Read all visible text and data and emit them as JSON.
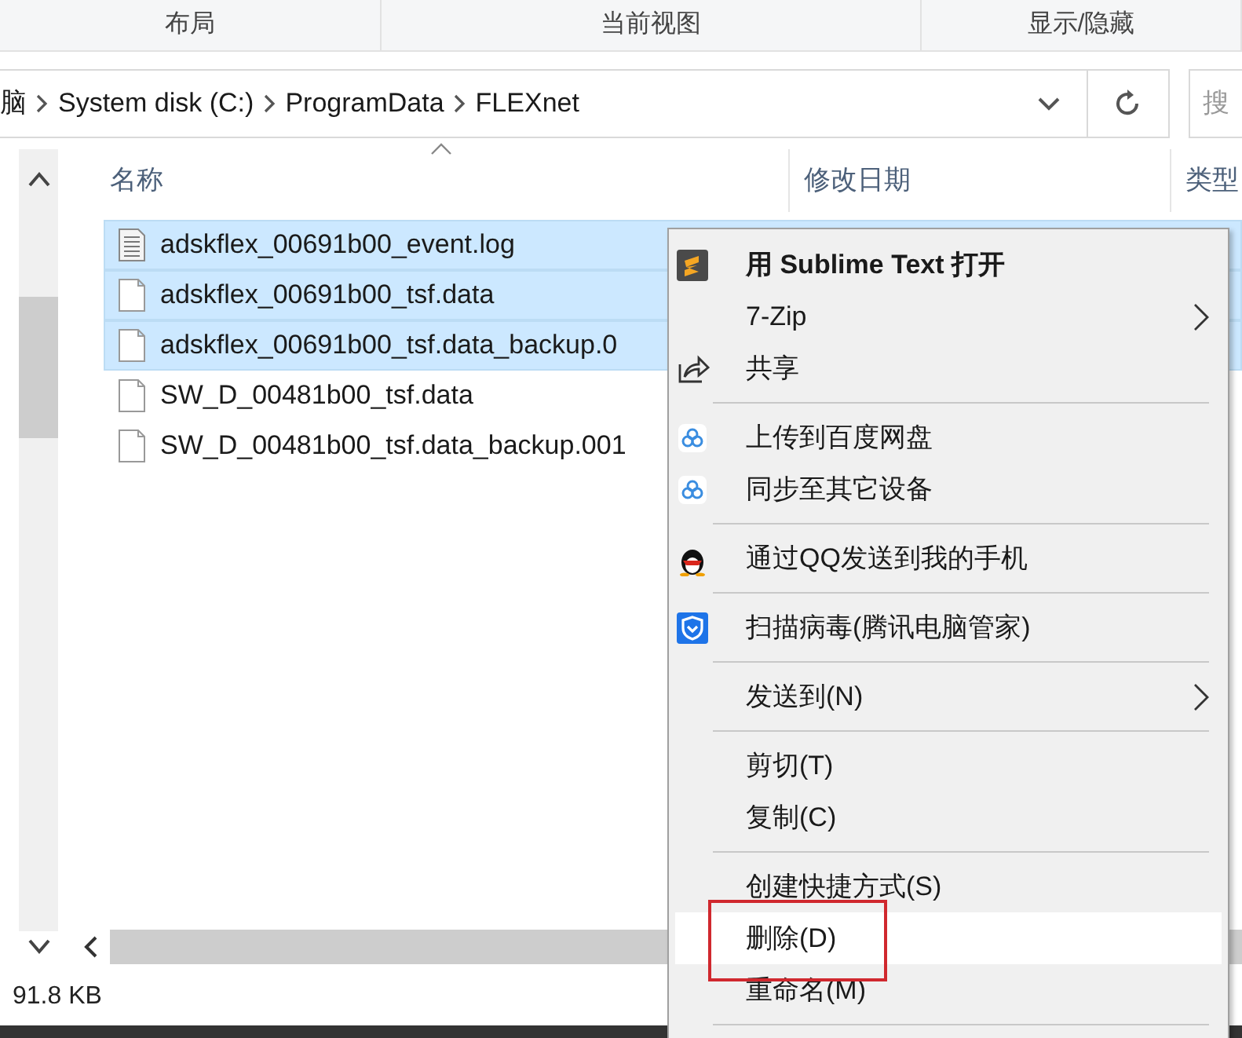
{
  "ribbon_groups": [
    "布局",
    "当前视图",
    "显示/隐藏"
  ],
  "address_bar": {
    "breadcrumbs": [
      "脑",
      "System disk (C:)",
      "ProgramData",
      "FLEXnet"
    ],
    "search_placeholder": "搜"
  },
  "columns": [
    "名称",
    "修改日期",
    "类型"
  ],
  "files": [
    {
      "name": "adskflex_00691b00_event.log",
      "kind": "text",
      "selected": true
    },
    {
      "name": "adskflex_00691b00_tsf.data",
      "kind": "blank",
      "selected": true
    },
    {
      "name": "adskflex_00691b00_tsf.data_backup.0",
      "kind": "blank",
      "selected": true
    },
    {
      "name": "SW_D_00481b00_tsf.data",
      "kind": "blank",
      "selected": false
    },
    {
      "name": "SW_D_00481b00_tsf.data_backup.001",
      "kind": "blank",
      "selected": false
    }
  ],
  "status_bar": {
    "size": "91.8 KB"
  },
  "context_menu": {
    "items": [
      {
        "kind": "item",
        "label": "用 Sublime Text 打开",
        "bold": true,
        "submenu": false,
        "selected": false
      },
      {
        "kind": "item",
        "label": "7-Zip",
        "submenu": true,
        "selected": false
      },
      {
        "kind": "item",
        "label": "共享",
        "submenu": false,
        "selected": false
      },
      {
        "kind": "separator"
      },
      {
        "kind": "item",
        "label": "上传到百度网盘",
        "submenu": false,
        "selected": false
      },
      {
        "kind": "item",
        "label": "同步至其它设备",
        "submenu": false,
        "selected": false
      },
      {
        "kind": "separator"
      },
      {
        "kind": "item",
        "label": "通过QQ发送到我的手机",
        "submenu": false,
        "selected": false
      },
      {
        "kind": "separator"
      },
      {
        "kind": "item",
        "label": "扫描病毒(腾讯电脑管家)",
        "submenu": false,
        "selected": false
      },
      {
        "kind": "separator"
      },
      {
        "kind": "item",
        "label": "发送到(N)",
        "submenu": true,
        "selected": false
      },
      {
        "kind": "separator"
      },
      {
        "kind": "item",
        "label": "剪切(T)",
        "submenu": false,
        "selected": false
      },
      {
        "kind": "item",
        "label": "复制(C)",
        "submenu": false,
        "selected": false
      },
      {
        "kind": "separator"
      },
      {
        "kind": "item",
        "label": "创建快捷方式(S)",
        "submenu": false,
        "selected": false
      },
      {
        "kind": "item",
        "label": "删除(D)",
        "submenu": false,
        "selected": true,
        "annotated": true
      },
      {
        "kind": "item",
        "label": "重命名(M)",
        "submenu": false,
        "selected": false
      },
      {
        "kind": "separator"
      }
    ]
  }
}
